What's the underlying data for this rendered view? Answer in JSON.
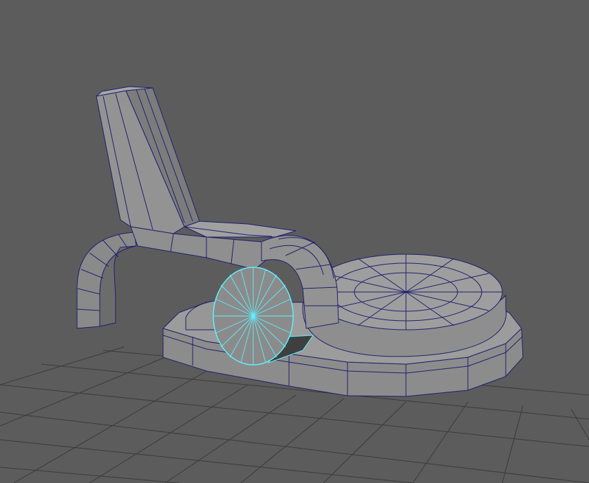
{
  "viewport": {
    "background": "#5c5c5c",
    "grid_color": "#3a3a3a",
    "model": {
      "fill_light": "#9a9a9a",
      "fill_mid": "#8a8a8a",
      "fill_dark": "#707070",
      "wire_color": "#1e1e6e",
      "selection_color": "#5ff0ff",
      "selected_object": "cylinder-wheel"
    }
  }
}
